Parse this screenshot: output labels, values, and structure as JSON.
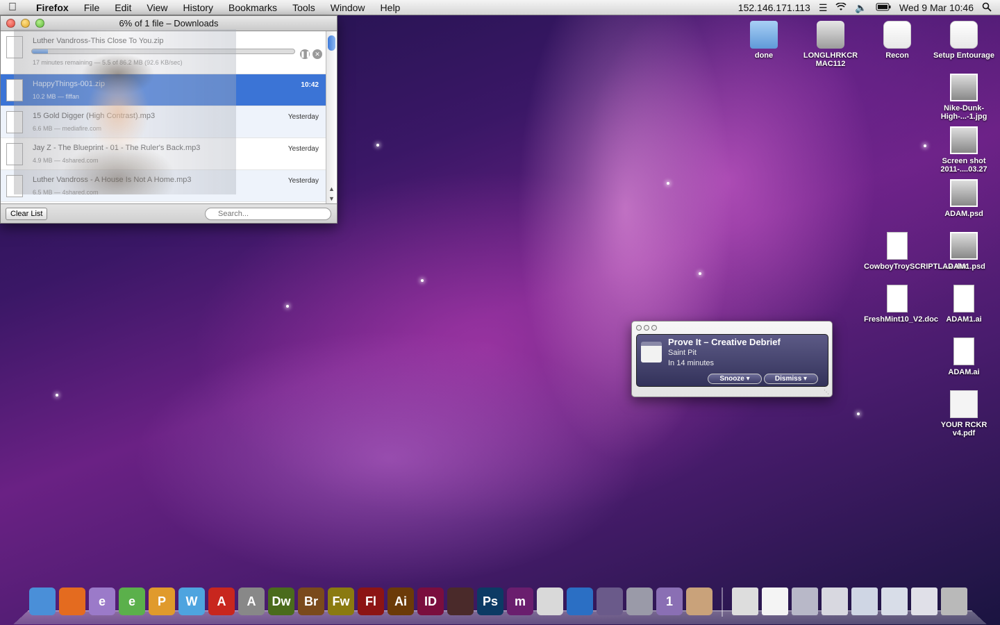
{
  "menubar": {
    "app_name": "Firefox",
    "menus": [
      "File",
      "Edit",
      "View",
      "History",
      "Bookmarks",
      "Tools",
      "Window",
      "Help"
    ],
    "ip_address": "152.146.171.113",
    "datetime": "Wed 9 Mar  10:46",
    "status_icons": [
      "script-icon",
      "wifi-icon",
      "volume-icon",
      "battery-icon",
      "spotlight-icon"
    ]
  },
  "downloads_window": {
    "title": "6% of 1 file – Downloads",
    "items": [
      {
        "name": "Luther Vandross-This Close To You.zip",
        "meta": "17 minutes remaining — 5.5 of 86.2 MB (92.6 KB/sec)",
        "time": "",
        "progress": 0.06
      },
      {
        "name": "HappyThings-001.zip",
        "meta": "10.2 MB — flffan",
        "time": "10:42"
      },
      {
        "name": "15 Gold Digger (High Contrast).mp3",
        "meta": "6.6 MB — mediafire.com",
        "time": "Yesterday"
      },
      {
        "name": "Jay Z - The Blueprint - 01 - The Ruler's Back.mp3",
        "meta": "4.9 MB — 4shared.com",
        "time": "Yesterday"
      },
      {
        "name": "Luther Vandross - A House Is Not A Home.mp3",
        "meta": "6.5 MB — 4shared.com",
        "time": "Yesterday"
      }
    ],
    "clear_label": "Clear List",
    "search_placeholder": "Search..."
  },
  "desktop_icons": [
    {
      "label": "done",
      "type": "folder"
    },
    {
      "label": "LONGLHRKCR MAC112",
      "type": "disk"
    },
    {
      "label": "Recon",
      "type": "app"
    },
    {
      "label": "Setup Entourage",
      "type": "app"
    },
    {
      "label": "Nike-Dunk-High-...-1.jpg",
      "type": "image"
    },
    {
      "label": "Screen shot 2011-....03.27",
      "type": "image"
    },
    {
      "label": "ADAM.psd",
      "type": "image"
    },
    {
      "label": "CowboyTroySCRIPTL...2.doc",
      "type": "doc"
    },
    {
      "label": "ADAM1.psd",
      "type": "image"
    },
    {
      "label": "FreshMint10_V2.doc",
      "type": "doc"
    },
    {
      "label": "ADAM1.ai",
      "type": "doc"
    },
    {
      "label": "ADAM.ai",
      "type": "doc"
    },
    {
      "label": "YOUR RCKR v4.pdf",
      "type": "pdf"
    }
  ],
  "reminder": {
    "title": "Prove It – Creative Debrief",
    "location": "Saint Pit",
    "when": "In 14 minutes",
    "snooze_label": "Snooze",
    "dismiss_label": "Dismiss"
  },
  "dock": {
    "apps": [
      {
        "name": "finder-icon",
        "label": "",
        "color": "#4a8fd8"
      },
      {
        "name": "firefox-icon",
        "label": "",
        "color": "#e46b1f"
      },
      {
        "name": "edge-animate-icon",
        "label": "e",
        "color": "#9b7ac9"
      },
      {
        "name": "edge-icon-2",
        "label": "e",
        "color": "#5bb04b"
      },
      {
        "name": "edge-icon-3",
        "label": "P",
        "color": "#e09a2c"
      },
      {
        "name": "edge-icon-4",
        "label": "W",
        "color": "#4ea4df"
      },
      {
        "name": "acrobat-icon",
        "label": "A",
        "color": "#c8261e"
      },
      {
        "name": "acrobat-distiller-icon",
        "label": "A",
        "color": "#888888"
      },
      {
        "name": "dreamweaver-icon",
        "label": "Dw",
        "color": "#4a6b1c"
      },
      {
        "name": "bridge-icon",
        "label": "Br",
        "color": "#7a4a1c"
      },
      {
        "name": "fireworks-icon",
        "label": "Fw",
        "color": "#8a7a10"
      },
      {
        "name": "flash-icon",
        "label": "Fl",
        "color": "#8c1414"
      },
      {
        "name": "illustrator-icon",
        "label": "Ai",
        "color": "#6b3a08"
      },
      {
        "name": "indesign-icon",
        "label": "ID",
        "color": "#7a0e3e"
      },
      {
        "name": "media-encoder-icon",
        "label": "",
        "color": "#4a2a2a"
      },
      {
        "name": "photoshop-icon",
        "label": "Ps",
        "color": "#0c3a64"
      },
      {
        "name": "m-app-icon",
        "label": "m",
        "color": "#6a1e6e"
      },
      {
        "name": "calendar-app-icon",
        "label": "",
        "color": "#d9d9d9"
      },
      {
        "name": "itunes-icon",
        "label": "",
        "color": "#2b6fc4"
      },
      {
        "name": "mydvd-icon",
        "label": "",
        "color": "#6a5a8a"
      },
      {
        "name": "preview-icon",
        "label": "",
        "color": "#9a9aa8"
      },
      {
        "name": "alarm-clock-icon",
        "label": "1",
        "color": "#8a6fb4"
      },
      {
        "name": "cat-icon",
        "label": "",
        "color": "#c9a27a"
      }
    ],
    "stacks": [
      {
        "name": "pdf-doc-icon",
        "color": "#dddddd"
      },
      {
        "name": "blank-doc-icon",
        "color": "#f4f4f4"
      },
      {
        "name": "screenshot-stack-icon",
        "color": "#b8b8c8"
      },
      {
        "name": "window-stack-icon",
        "color": "#d8d8e0"
      },
      {
        "name": "window-stack-icon-2",
        "color": "#cfd6e4"
      },
      {
        "name": "firefox-window-icon",
        "color": "#d8dde8"
      },
      {
        "name": "itunes-window-icon",
        "color": "#e0e0e8"
      },
      {
        "name": "trash-icon",
        "color": "#b9b9b9"
      }
    ]
  }
}
